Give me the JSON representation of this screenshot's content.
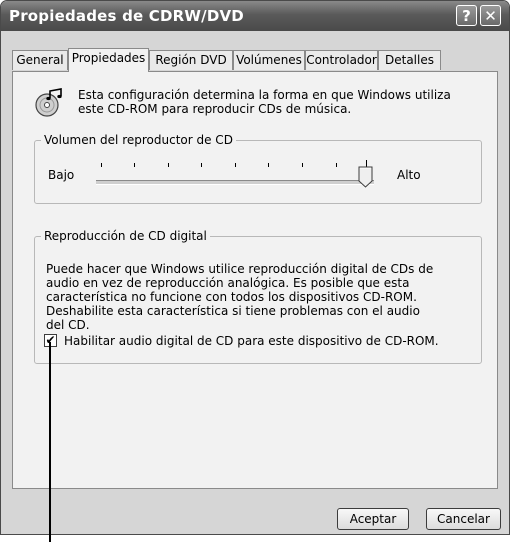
{
  "window": {
    "title": "Propiedades de CDRW/DVD",
    "help_label": "?",
    "close_label": "✕"
  },
  "tabs": [
    {
      "label": "General"
    },
    {
      "label": "Propiedades",
      "active": true
    },
    {
      "label": "Región DVD"
    },
    {
      "label": "Volúmenes"
    },
    {
      "label": "Controlador"
    },
    {
      "label": "Detalles"
    }
  ],
  "intro": {
    "icon": "cd-audio-icon",
    "text": "Esta configuración determina la forma en que Windows utiliza este CD-ROM para reproducir CDs de música."
  },
  "volume_group": {
    "title": "Volumen del reproductor de CD",
    "low_label": "Bajo",
    "high_label": "Alto",
    "level": 1.0
  },
  "digital_group": {
    "title": "Reproducción de CD digital",
    "description": "Puede hacer que Windows utilice reproducción digital de CDs de audio en vez de reproducción analógica. Es posible que esta característica no funcione con todos los dispositivos CD-ROM. Deshabilite esta característica si tiene problemas con el audio del CD.",
    "checkbox_label": "Habilitar audio digital de CD para este dispositivo de CD-ROM.",
    "checked": true,
    "check_mark": "✔"
  },
  "buttons": {
    "ok_label": "Aceptar",
    "cancel_label": "Cancelar"
  }
}
